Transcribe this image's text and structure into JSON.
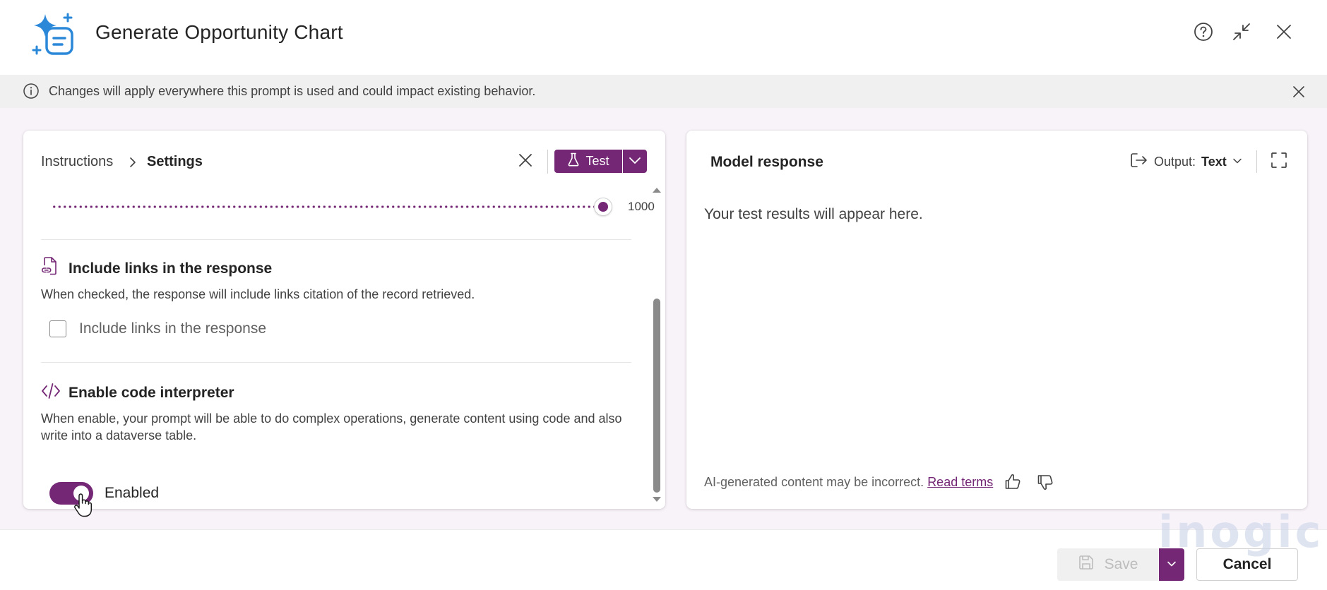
{
  "header": {
    "title": "Generate Opportunity Chart",
    "icons": [
      "sparkle-prompt-icon",
      "help-icon",
      "minimize-icon",
      "close-icon"
    ]
  },
  "banner": {
    "text": "Changes will apply everywhere this prompt is used and could impact existing behavior."
  },
  "left_panel": {
    "breadcrumb": {
      "instructions": "Instructions",
      "settings": "Settings"
    },
    "test_button": "Test",
    "slider": {
      "value": "1000",
      "level": 1.0
    },
    "include_links": {
      "title": "Include links in the response",
      "description": "When checked, the response will include links citation of the record retrieved.",
      "checkbox_label": "Include links in the response",
      "checked": false
    },
    "code_interpreter": {
      "title": "Enable code interpreter",
      "description": "When enable, your prompt will be able to do complex operations, generate content using code and also write into a dataverse table.",
      "toggle_label": "Enabled",
      "enabled": true
    }
  },
  "right_panel": {
    "title": "Model response",
    "output_label": "Output:",
    "output_value": "Text",
    "placeholder": "Your test results will appear here.",
    "disclaimer": "AI-generated content may be incorrect.",
    "read_terms": "Read terms"
  },
  "footer": {
    "save_label": "Save",
    "cancel_label": "Cancel"
  },
  "watermark": "inogic",
  "colors": {
    "accent": "#742774",
    "banner_bg": "#f0f0f0",
    "content_bg": "#f8f3f9",
    "logo_blue": "#2b88d8"
  }
}
